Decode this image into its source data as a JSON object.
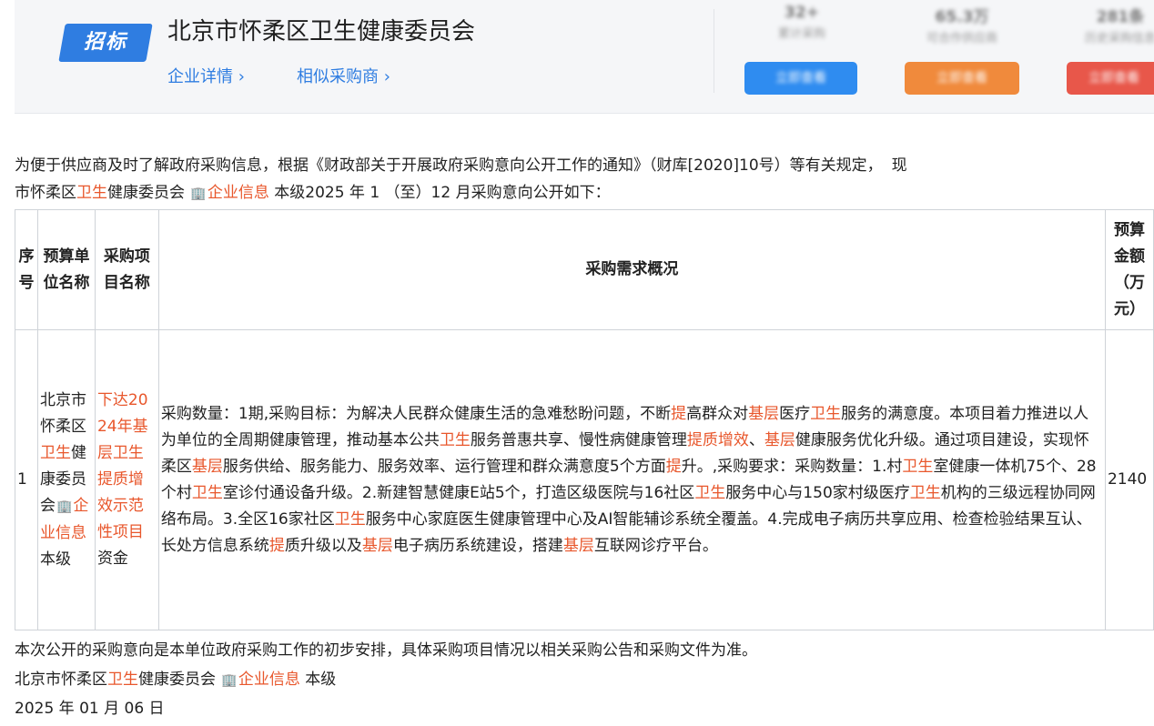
{
  "header": {
    "badge": "招标",
    "org_name": "北京市怀柔区卫生健康委员会",
    "links": [
      "企业详情 ›",
      "相似采购商 ›"
    ],
    "stats": [
      {
        "value": "32+",
        "label": "累计采购",
        "button": "立即查看",
        "color": "#2f8cf0"
      },
      {
        "value": "65.3万",
        "label": "可合作供应商",
        "button": "立即查看",
        "color": "#f08a3c"
      },
      {
        "value": "281条",
        "label": "历史采购信息",
        "button": "立即查看",
        "color": "#e8574a"
      }
    ]
  },
  "intro": {
    "line1": "为便于供应商及时了解政府采购信息，根据《财政部关于开展政府采购意向公开工作的通知》（财库[2020]10号）等有关规定，",
    "line1_tail": "现",
    "line2_pre": "市怀柔区",
    "hl_weisheng": "卫生",
    "line2_mid": "健康委员会",
    "company_info": "企业信息",
    "line2_post": "本级2025 年 1 （至）12 月采购意向公开如下："
  },
  "table": {
    "headers": [
      "序号",
      "预算单位名称",
      "采购项目名称",
      "采购需求概况",
      "预算金额（万元）"
    ],
    "row": {
      "index": "1",
      "unit_pre": "北京市怀柔区",
      "unit_mid": "健康委员会",
      "unit_post": "本级",
      "project_pre": "下达2024年",
      "project_jc": "基层",
      "project_mid": "卫生提质增效示范性项目",
      "project_post": "资金",
      "amount": "2140"
    },
    "desc_parts": [
      "采购数量：1期,采购目标：为解决人民群众健康生活的急难愁盼问题，不断",
      "提",
      "高群众对",
      "基层",
      "医疗",
      "卫生",
      "服务的满意度。本项目着力推进以人为单位的全周期健康管理，推动基本公共",
      "卫生",
      "服务普惠共享、慢性病健康管理",
      "提质增效",
      "、",
      "基层",
      "健康服务优化升级。通过项目建设，实现怀柔区",
      "基层",
      "服务供给、服务能力、服务效率、运行管理和群众满意度5个方面",
      "提",
      "升。,采购要求：采购数量：1.村",
      "卫生",
      "室健康一体机75个、28个村",
      "卫生",
      "室诊付通设备升级。2.新建智慧健康E站5个，打造区级医院与16社区",
      "卫生",
      "服务中心与150家村级医疗",
      "卫生",
      "机构的三级远程协同网络布局。3.全区16家社区",
      "卫生",
      "服务中心家庭医生健康管理中心及AI智能辅诊系统全覆盖。4.完成电子病历共享应用、检查检验结果互认、长处方信息系统",
      "提",
      "质升级以及",
      "基层",
      "电子病历系统建设，搭建",
      "基层",
      "互联网诊疗平台。"
    ]
  },
  "footer": {
    "note": "本次公开的采购意向是本单位政府采购工作的初步安排，具体采购项目情况以相关采购公告和采购文件为准。",
    "sign_pre": "北京市怀柔区",
    "sign_mid": "健康委员会",
    "sign_post": "本级",
    "date": "2025 年 01 月 06 日"
  },
  "icons": {
    "building": "building-icon"
  }
}
